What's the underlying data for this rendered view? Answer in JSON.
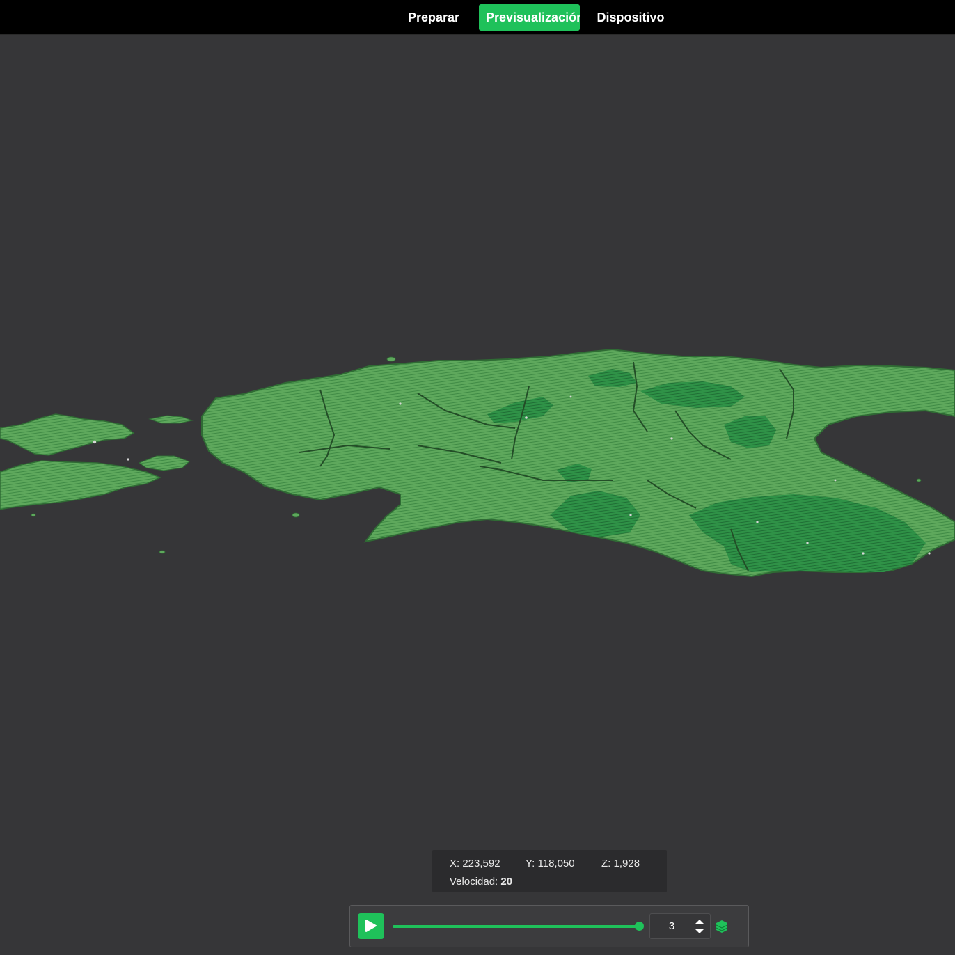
{
  "tabs": {
    "prepare": "Preparar",
    "preview": "Previsualización",
    "device": "Dispositivo"
  },
  "info": {
    "x": "X: 223,592",
    "y": "Y: 118,050",
    "z": "Z: 1,928",
    "speed_label": "Velocidad:",
    "speed_value": "20"
  },
  "playback": {
    "layer_value": "3",
    "progress": 1.0
  },
  "icons": {
    "play": "play-icon",
    "spin": "spin-arrows-icon",
    "layers": "layers-icon"
  },
  "colors": {
    "accent": "#1fc15a",
    "background": "#363638",
    "topbar": "#000000",
    "terrain_light": "#5aa85a",
    "terrain_dark": "#2a8a44"
  }
}
